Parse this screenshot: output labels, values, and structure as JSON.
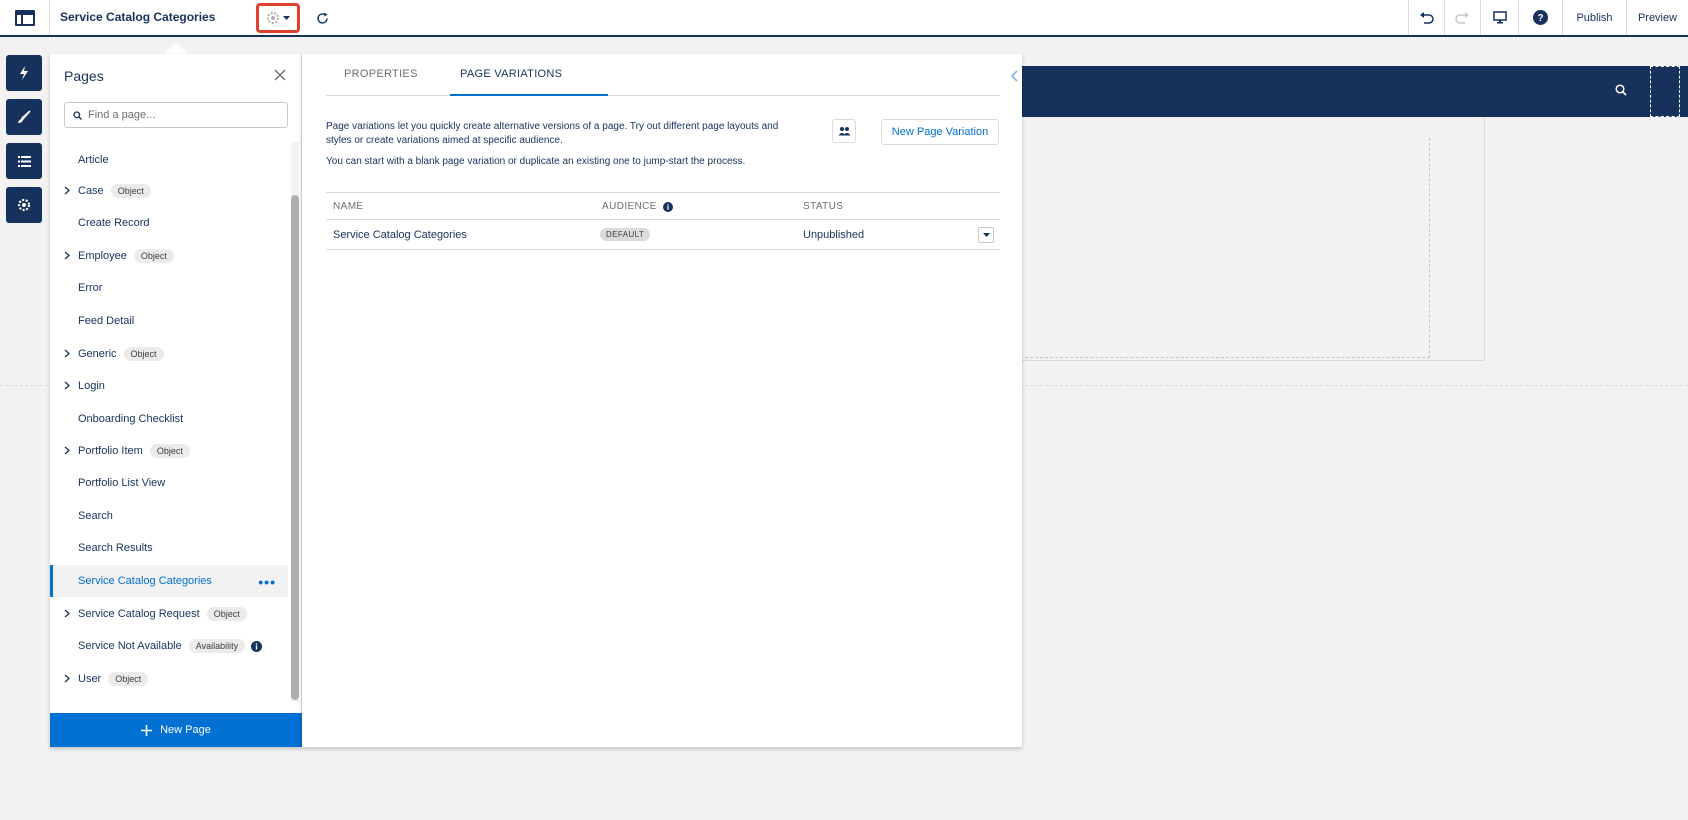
{
  "topbar": {
    "title": "Service Catalog Categories",
    "publish_label": "Publish",
    "preview_label": "Preview"
  },
  "pages_panel": {
    "title": "Pages",
    "search_placeholder": "Find a page...",
    "items": [
      {
        "label": "Article",
        "expandable": false,
        "badge": ""
      },
      {
        "label": "Case",
        "expandable": true,
        "badge": "Object"
      },
      {
        "label": "Create Record",
        "expandable": false,
        "badge": ""
      },
      {
        "label": "Employee",
        "expandable": true,
        "badge": "Object"
      },
      {
        "label": "Error",
        "expandable": false,
        "badge": ""
      },
      {
        "label": "Feed Detail",
        "expandable": false,
        "badge": ""
      },
      {
        "label": "Generic",
        "expandable": true,
        "badge": "Object"
      },
      {
        "label": "Login",
        "expandable": true,
        "badge": ""
      },
      {
        "label": "Onboarding Checklist",
        "expandable": false,
        "badge": ""
      },
      {
        "label": "Portfolio Item",
        "expandable": true,
        "badge": "Object"
      },
      {
        "label": "Portfolio List View",
        "expandable": false,
        "badge": ""
      },
      {
        "label": "Search",
        "expandable": false,
        "badge": ""
      },
      {
        "label": "Search Results",
        "expandable": false,
        "badge": ""
      },
      {
        "label": "Service Catalog Categories",
        "expandable": false,
        "badge": "",
        "active": true
      },
      {
        "label": "Service Catalog Request",
        "expandable": true,
        "badge": "Object"
      },
      {
        "label": "Service Not Available",
        "expandable": false,
        "badge": "Availability"
      },
      {
        "label": "User",
        "expandable": true,
        "badge": "Object"
      }
    ],
    "new_page_label": "New Page"
  },
  "props_panel": {
    "tabs": [
      "PROPERTIES",
      "PAGE VARIATIONS"
    ],
    "active_tab": "PAGE VARIATIONS",
    "description": "Page variations let you quickly create alternative versions of a page. Try out different page layouts and styles or create variations aimed at specific audience.",
    "description2": "You can start with a blank page variation or duplicate an existing one to jump-start the process.",
    "new_variation_label": "New Page Variation",
    "table": {
      "headers": [
        "NAME",
        "AUDIENCE",
        "STATUS"
      ],
      "rows": [
        {
          "name": "Service Catalog Categories",
          "audience": "DEFAULT",
          "status": "Unpublished"
        }
      ]
    }
  },
  "colors": {
    "navy": "#16325c",
    "accent": "#0070d2",
    "highlight": "#e0412f"
  }
}
